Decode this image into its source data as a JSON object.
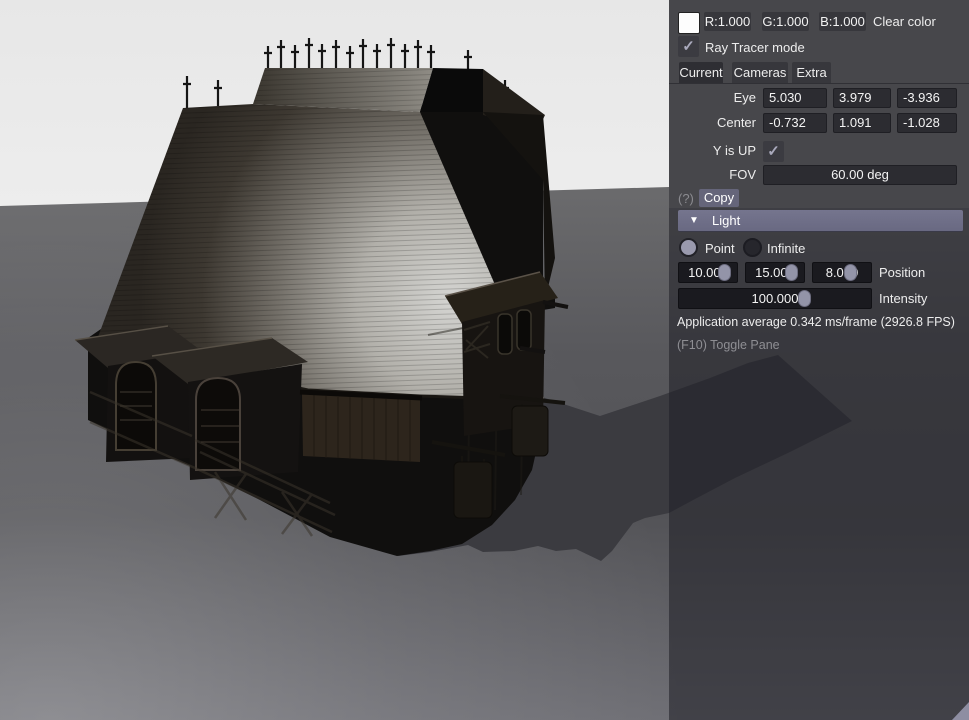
{
  "viewport": {
    "description": "3D preview: dark medieval timber house with glowing roof highlight on gray ground plane",
    "colors": {
      "sky": "#e9e9e9",
      "ground_near": "#7e7e84",
      "ground_far": "#59595d",
      "shadow": "#3b3b40",
      "roof_highlight": "#d2d2cf",
      "house_dark": "#100f0e"
    }
  },
  "icons": {
    "check": "✓",
    "collapse_triangle": "▼"
  },
  "panel": {
    "colors": {
      "panel_bg": "#47474b",
      "field_bg": "#2c2c31",
      "slider_bg": "#1a1a1f",
      "light_bar": "#6f6f88",
      "handle": "#9394a8",
      "resize_grip": "#8e8ea2",
      "swatch": "#ffffff"
    },
    "color_row": {
      "r": "R:1.000",
      "g": "G:1.000",
      "b": "B:1.000",
      "clear_label": "Clear color"
    },
    "ray_tracer_label": "Ray Tracer mode",
    "tabs": {
      "current": "Current",
      "cameras": "Cameras",
      "extra": "Extra",
      "active": "Current"
    },
    "camera": {
      "eye_label": "Eye",
      "eye": [
        "5.030",
        "3.979",
        "-3.936"
      ],
      "center_label": "Center",
      "center": [
        "-0.732",
        "1.091",
        "-1.028"
      ],
      "y_up_label": "Y is UP",
      "fov_label": "FOV",
      "fov_value": "60.00 deg"
    },
    "help_label": "(?)",
    "copy_label": "Copy",
    "light": {
      "title": "Light",
      "point_label": "Point",
      "infinite_label": "Infinite",
      "selected_mode": "Point",
      "position": [
        "10.000",
        "15.000",
        "8.000"
      ],
      "position_label": "Position",
      "intensity": "100.000",
      "intensity_label": "Intensity"
    },
    "stats": "Application average 0.342 ms/frame (2926.8 FPS)",
    "toggle_hint": "(F10) Toggle Pane"
  }
}
